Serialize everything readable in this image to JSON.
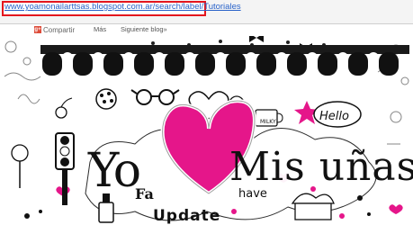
{
  "address_bar": {
    "url": "www.yoamonailarttsas.blogspot.com.ar/search/label/Tutoriales"
  },
  "toolbar": {
    "share_icon_text": "g+",
    "share_label": "Compartir",
    "more_label": "Más",
    "next_blog_label": "Siguiente blog»"
  },
  "header": {
    "title_left": "Yo",
    "title_right": "Mis uñas",
    "doodle_words": {
      "hello": "Hello",
      "milky": "MILKY",
      "have": "have",
      "update": "Update",
      "fa": "Fa"
    }
  },
  "colors": {
    "accent_pink": "#e5168a",
    "url_highlight": "#e3161e",
    "link_blue": "#2a63c9"
  }
}
